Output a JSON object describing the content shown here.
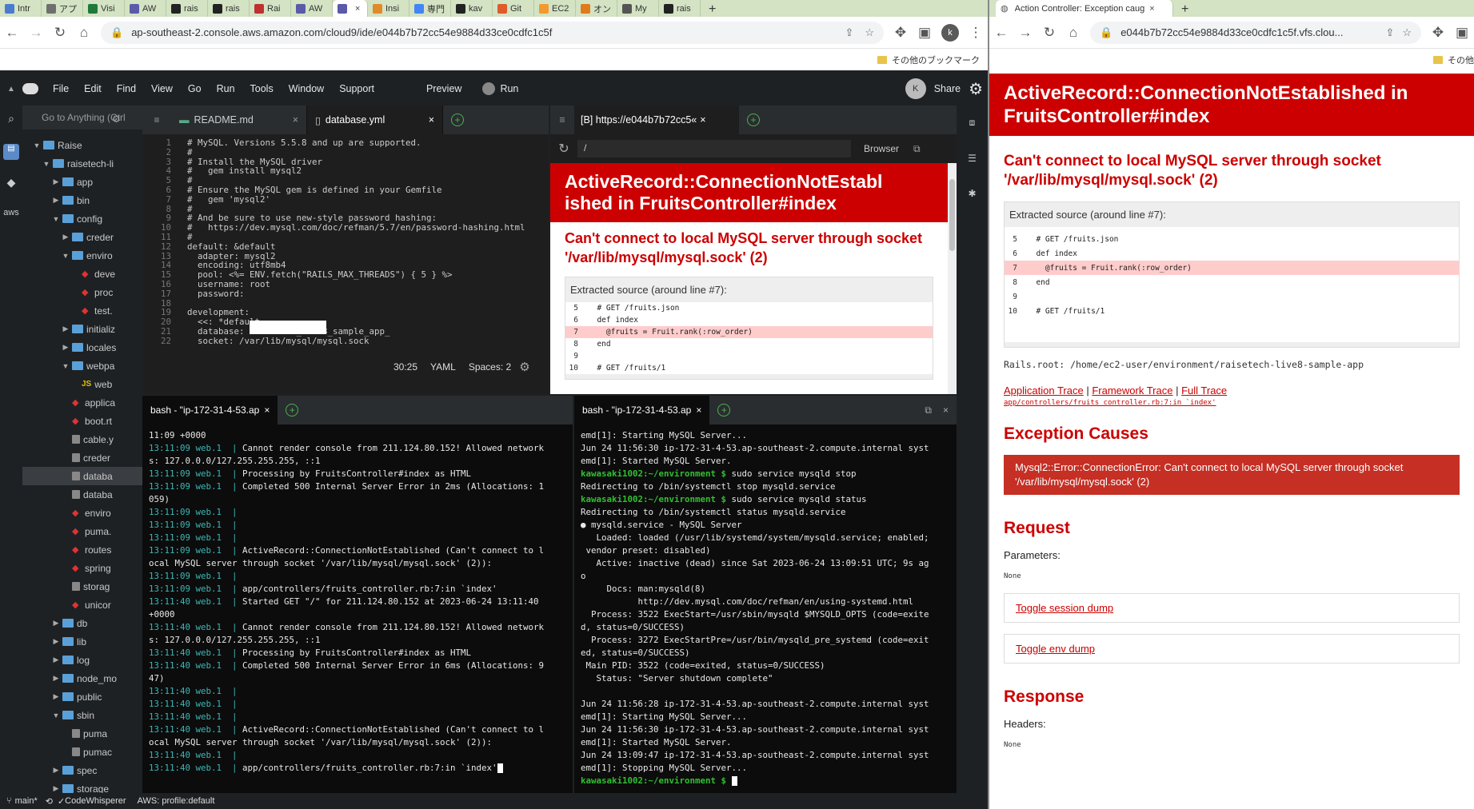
{
  "left_window": {
    "tabs": [
      {
        "label": "Intr",
        "color": "#4a7bd0"
      },
      {
        "label": "アプ",
        "color": "#6f6f6f"
      },
      {
        "label": "Visi",
        "color": "#1f7a3a"
      },
      {
        "label": "AW",
        "color": "#5a5aa8"
      },
      {
        "label": "rais",
        "color": "#222222"
      },
      {
        "label": "rais",
        "color": "#222222"
      },
      {
        "label": "Rai",
        "color": "#c03030"
      },
      {
        "label": "AW",
        "color": "#5a5aa8"
      },
      {
        "label": "",
        "color": "#5a5aa8",
        "active": true
      },
      {
        "label": "Insi",
        "color": "#e08a2a"
      },
      {
        "label": "専門",
        "color": "#4285f4"
      },
      {
        "label": "kav",
        "color": "#222222"
      },
      {
        "label": "Git",
        "color": "#e05a2a"
      },
      {
        "label": "EC2",
        "color": "#f29a2e"
      },
      {
        "label": "オン",
        "color": "#e07a1a"
      },
      {
        "label": "My",
        "color": "#555555"
      },
      {
        "label": "rais",
        "color": "#222222"
      }
    ],
    "url": "ap-southeast-2.console.aws.amazon.com/cloud9/ide/e044b7b72cc54e9884d33ce0cdfc1c5f",
    "bookmark_folder": "その他のブックマーク",
    "profile_letter": "k"
  },
  "c9": {
    "menu": [
      "File",
      "Edit",
      "Find",
      "View",
      "Go",
      "Run",
      "Tools",
      "Window",
      "Support"
    ],
    "preview": "Preview",
    "run": "Run",
    "avatar": "K",
    "share": "Share",
    "goto_placeholder": "Go to Anything (Ctrl",
    "editor_tabs": [
      "README.md",
      "database.yml"
    ],
    "browser_tab": "[B] https://e044b7b72cc5«",
    "browser_path": "/",
    "browser_btn": "Browser",
    "status_pos": "30:25",
    "status_lang": "YAML",
    "status_spaces": "Spaces: 2",
    "tree": [
      {
        "label": "Raise",
        "type": "root",
        "indent": 0
      },
      {
        "label": "raisetech-li",
        "type": "folder-open",
        "indent": 1
      },
      {
        "label": "app",
        "type": "folder",
        "indent": 2
      },
      {
        "label": "bin",
        "type": "folder",
        "indent": 2
      },
      {
        "label": "config",
        "type": "folder-open",
        "indent": 2
      },
      {
        "label": "creder",
        "type": "folder",
        "indent": 3
      },
      {
        "label": "enviro",
        "type": "folder-open",
        "indent": 3
      },
      {
        "label": "deve",
        "type": "ruby",
        "indent": 4
      },
      {
        "label": "proc",
        "type": "ruby",
        "indent": 4
      },
      {
        "label": "test.",
        "type": "ruby",
        "indent": 4
      },
      {
        "label": "initializ",
        "type": "folder",
        "indent": 3
      },
      {
        "label": "locales",
        "type": "folder",
        "indent": 3
      },
      {
        "label": "webpa",
        "type": "folder-open",
        "indent": 3
      },
      {
        "label": "web",
        "type": "js",
        "indent": 4
      },
      {
        "label": "applica",
        "type": "ruby",
        "indent": 3
      },
      {
        "label": "boot.rt",
        "type": "ruby",
        "indent": 3
      },
      {
        "label": "cable.y",
        "type": "file",
        "indent": 3
      },
      {
        "label": "creder",
        "type": "file",
        "indent": 3
      },
      {
        "label": "databa",
        "type": "file",
        "indent": 3,
        "selected": true
      },
      {
        "label": "databa",
        "type": "file",
        "indent": 3
      },
      {
        "label": "enviro",
        "type": "ruby",
        "indent": 3
      },
      {
        "label": "puma.",
        "type": "ruby",
        "indent": 3
      },
      {
        "label": "routes",
        "type": "ruby",
        "indent": 3
      },
      {
        "label": "spring",
        "type": "ruby",
        "indent": 3
      },
      {
        "label": "storag",
        "type": "file",
        "indent": 3
      },
      {
        "label": "unicor",
        "type": "ruby",
        "indent": 3
      },
      {
        "label": "db",
        "type": "folder",
        "indent": 2
      },
      {
        "label": "lib",
        "type": "folder",
        "indent": 2
      },
      {
        "label": "log",
        "type": "folder",
        "indent": 2
      },
      {
        "label": "node_mo",
        "type": "folder",
        "indent": 2
      },
      {
        "label": "public",
        "type": "folder",
        "indent": 2
      },
      {
        "label": "sbin",
        "type": "folder-open",
        "indent": 2
      },
      {
        "label": "puma",
        "type": "file",
        "indent": 3
      },
      {
        "label": "pumac",
        "type": "file",
        "indent": 3
      },
      {
        "label": "spec",
        "type": "folder",
        "indent": 2
      },
      {
        "label": "storage",
        "type": "folder",
        "indent": 2
      }
    ],
    "code": [
      "# MySQL. Versions 5.5.8 and up are supported.",
      "#",
      "# Install the MySQL driver",
      "#   gem install mysql2",
      "#",
      "# Ensure the MySQL gem is defined in your Gemfile",
      "#   gem 'mysql2'",
      "#",
      "# And be sure to use new-style password hashing:",
      "#   https://dev.mysql.com/doc/refman/5.7/en/password-hashing.html",
      "#",
      "default: &default",
      "  adapter: mysql2",
      "  encoding: utf8mb4",
      "  pool: <%= ENV.fetch(\"RAILS_MAX_THREADS\") { 5 } %>",
      "  username: root",
      "  password: ",
      "",
      "development:",
      "  <<: *default",
      "  database: raisetech_live8_sample_app_",
      "  socket: /var/lib/mysql/mysql.sock"
    ],
    "term_tabs": [
      "bash - \"ip-172-31-4-53.ap",
      "bash - \"ip-172-31-4-53.ap"
    ],
    "term1": [
      [
        "",
        "11:09 +0000"
      ],
      [
        "13:11:09 web.1  | ",
        "Cannot render console from 211.124.80.152! Allowed network"
      ],
      [
        "",
        "s: 127.0.0.0/127.255.255.255, ::1"
      ],
      [
        "13:11:09 web.1  | ",
        "Processing by FruitsController#index as HTML"
      ],
      [
        "13:11:09 web.1  | ",
        "Completed 500 Internal Server Error in 2ms (Allocations: 1"
      ],
      [
        "",
        "059)"
      ],
      [
        "13:11:09 web.1  | ",
        ""
      ],
      [
        "13:11:09 web.1  | ",
        ""
      ],
      [
        "13:11:09 web.1  | ",
        ""
      ],
      [
        "13:11:09 web.1  | ",
        "ActiveRecord::ConnectionNotEstablished (Can't connect to l"
      ],
      [
        "",
        "ocal MySQL server through socket '/var/lib/mysql/mysql.sock' (2)):"
      ],
      [
        "13:11:09 web.1  | ",
        ""
      ],
      [
        "13:11:09 web.1  | ",
        "app/controllers/fruits_controller.rb:7:in `index'"
      ],
      [
        "13:11:40 web.1  | ",
        "Started GET \"/\" for 211.124.80.152 at 2023-06-24 13:11:40"
      ],
      [
        "",
        "+0000"
      ],
      [
        "13:11:40 web.1  | ",
        "Cannot render console from 211.124.80.152! Allowed network"
      ],
      [
        "",
        "s: 127.0.0.0/127.255.255.255, ::1"
      ],
      [
        "13:11:40 web.1  | ",
        "Processing by FruitsController#index as HTML"
      ],
      [
        "13:11:40 web.1  | ",
        "Completed 500 Internal Server Error in 6ms (Allocations: 9"
      ],
      [
        "",
        "47)"
      ],
      [
        "13:11:40 web.1  | ",
        ""
      ],
      [
        "13:11:40 web.1  | ",
        ""
      ],
      [
        "13:11:40 web.1  | ",
        ""
      ],
      [
        "13:11:40 web.1  | ",
        "ActiveRecord::ConnectionNotEstablished (Can't connect to l"
      ],
      [
        "",
        "ocal MySQL server through socket '/var/lib/mysql/mysql.sock' (2)):"
      ],
      [
        "13:11:40 web.1  | ",
        ""
      ],
      [
        "13:11:40 web.1  | ",
        "app/controllers/fruits_controller.rb:7:in `index'"
      ]
    ],
    "term2": [
      [
        "",
        "emd[1]: Starting MySQL Server..."
      ],
      [
        "",
        "Jun 24 11:56:30 ip-172-31-4-53.ap-southeast-2.compute.internal syst"
      ],
      [
        "",
        "emd[1]: Started MySQL Server."
      ],
      [
        "kawasaki1002:~/environment $ ",
        "sudo service mysqld stop"
      ],
      [
        "",
        "Redirecting to /bin/systemctl stop mysqld.service"
      ],
      [
        "kawasaki1002:~/environment $ ",
        "sudo service mysqld status"
      ],
      [
        "",
        "Redirecting to /bin/systemctl status mysqld.service"
      ],
      [
        "",
        "● mysqld.service - MySQL Server"
      ],
      [
        "",
        "   Loaded: loaded (/usr/lib/systemd/system/mysqld.service; enabled;"
      ],
      [
        "",
        " vendor preset: disabled)"
      ],
      [
        "",
        "   Active: inactive (dead) since Sat 2023-06-24 13:09:51 UTC; 9s ag"
      ],
      [
        "",
        "o"
      ],
      [
        "",
        "     Docs: man:mysqld(8)"
      ],
      [
        "",
        "           http://dev.mysql.com/doc/refman/en/using-systemd.html"
      ],
      [
        "",
        "  Process: 3522 ExecStart=/usr/sbin/mysqld $MYSQLD_OPTS (code=exite"
      ],
      [
        "",
        "d, status=0/SUCCESS)"
      ],
      [
        "",
        "  Process: 3272 ExecStartPre=/usr/bin/mysqld_pre_systemd (code=exit"
      ],
      [
        "",
        "ed, status=0/SUCCESS)"
      ],
      [
        "",
        " Main PID: 3522 (code=exited, status=0/SUCCESS)"
      ],
      [
        "",
        "   Status: \"Server shutdown complete\""
      ],
      [
        "",
        ""
      ],
      [
        "",
        "Jun 24 11:56:28 ip-172-31-4-53.ap-southeast-2.compute.internal syst"
      ],
      [
        "",
        "emd[1]: Starting MySQL Server..."
      ],
      [
        "",
        "Jun 24 11:56:30 ip-172-31-4-53.ap-southeast-2.compute.internal syst"
      ],
      [
        "",
        "emd[1]: Started MySQL Server."
      ],
      [
        "",
        "Jun 24 13:09:47 ip-172-31-4-53.ap-southeast-2.compute.internal syst"
      ],
      [
        "",
        "emd[1]: Stopping MySQL Server..."
      ],
      [
        "kawasaki1002:~/environment $ ",
        ""
      ]
    ],
    "statusbar": [
      "main*",
      "CodeWhisperer",
      "AWS: profile:default"
    ]
  },
  "rails_error": {
    "title": "ActiveRecord::ConnectionNotEstablished in FruitsController#index",
    "title_small": "ActiveRecord::ConnectionNotEstabl ished in FruitsController#index",
    "message": "Can't connect to local MySQL server through socket '/var/lib/mysql/mysql.sock' (2)",
    "extracted_label": "Extracted source (around line #7):",
    "source": [
      {
        "n": "5",
        "code": "  # GET /fruits.json"
      },
      {
        "n": "6",
        "code": "  def index"
      },
      {
        "n": "7",
        "code": "    @fruits = Fruit.rank(:row_order)",
        "hl": true
      },
      {
        "n": "8",
        "code": "  end"
      },
      {
        "n": "9",
        "code": ""
      },
      {
        "n": "10",
        "code": "  # GET /fruits/1"
      }
    ],
    "rails_root": "Rails.root: /home/ec2-user/environment/raisetech-live8-sample-app",
    "trace_links": [
      "Application Trace",
      "Framework Trace",
      "Full Trace"
    ],
    "trace_line": "app/controllers/fruits_controller.rb:7:in `index'",
    "exception_causes": "Exception Causes",
    "cause": "Mysql2::Error::ConnectionError: Can't connect to local MySQL server through socket '/var/lib/mysql/mysql.sock' (2)",
    "request": "Request",
    "parameters": "Parameters:",
    "none": "None",
    "toggle_session": "Toggle session dump",
    "toggle_env": "Toggle env dump",
    "response": "Response",
    "headers": "Headers:"
  },
  "right_window": {
    "tab_title": "Action Controller: Exception caug",
    "url": "e044b7b72cc54e9884d33ce0cdfc1c5f.vfs.clou...",
    "bookmark_folder": "その他"
  }
}
